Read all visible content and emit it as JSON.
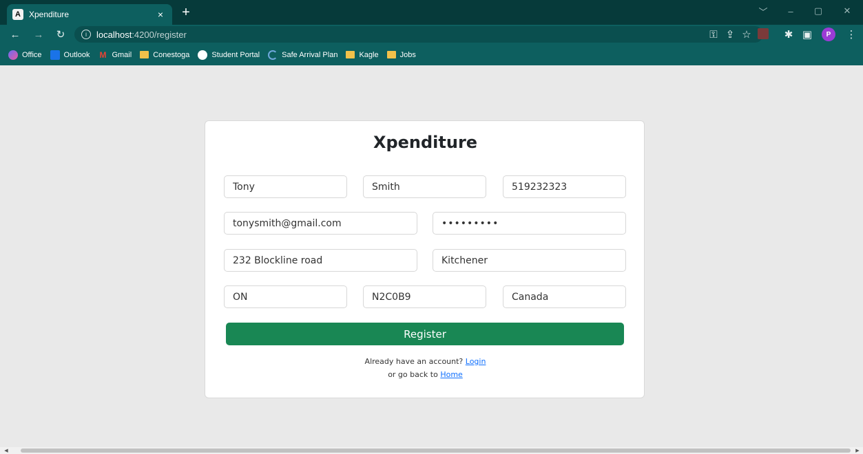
{
  "browser": {
    "tab_title": "Xpenditure",
    "tab_favicon": "A",
    "tab_close": "×",
    "new_tab": "+",
    "window_controls": [
      "﹀",
      "–",
      "▢",
      "✕"
    ],
    "url_host": "localhost",
    "url_path": ":4200/register",
    "profile_initial": "P",
    "bookmarks": [
      {
        "label": "Office",
        "icon": "office-icon"
      },
      {
        "label": "Outlook",
        "icon": "outlook-icon"
      },
      {
        "label": "Gmail",
        "icon": "gmail-icon"
      },
      {
        "label": "Conestoga",
        "icon": "folder-icon"
      },
      {
        "label": "Student Portal",
        "icon": "globe-icon"
      },
      {
        "label": "Safe Arrival Plan",
        "icon": "arc-icon"
      },
      {
        "label": "Kagle",
        "icon": "folder-icon"
      },
      {
        "label": "Jobs",
        "icon": "folder-icon"
      }
    ]
  },
  "page": {
    "title": "Xpenditure",
    "fields": {
      "first_name": "Tony",
      "last_name": "Smith",
      "phone": "519232323",
      "email": "tonysmith@gmail.com",
      "password": "•••••••••",
      "address": "232 Blockline road",
      "city": "Kitchener",
      "province": "ON",
      "postal_code": "N2C0B9",
      "country": "Canada"
    },
    "register_label": "Register",
    "account_prompt": "Already have an account?",
    "login_link": "Login",
    "home_prompt": "or go back to",
    "home_link": "Home"
  },
  "colors": {
    "chrome": "#0d5f5f",
    "register_button": "#198754",
    "link": "#0d6efd"
  }
}
